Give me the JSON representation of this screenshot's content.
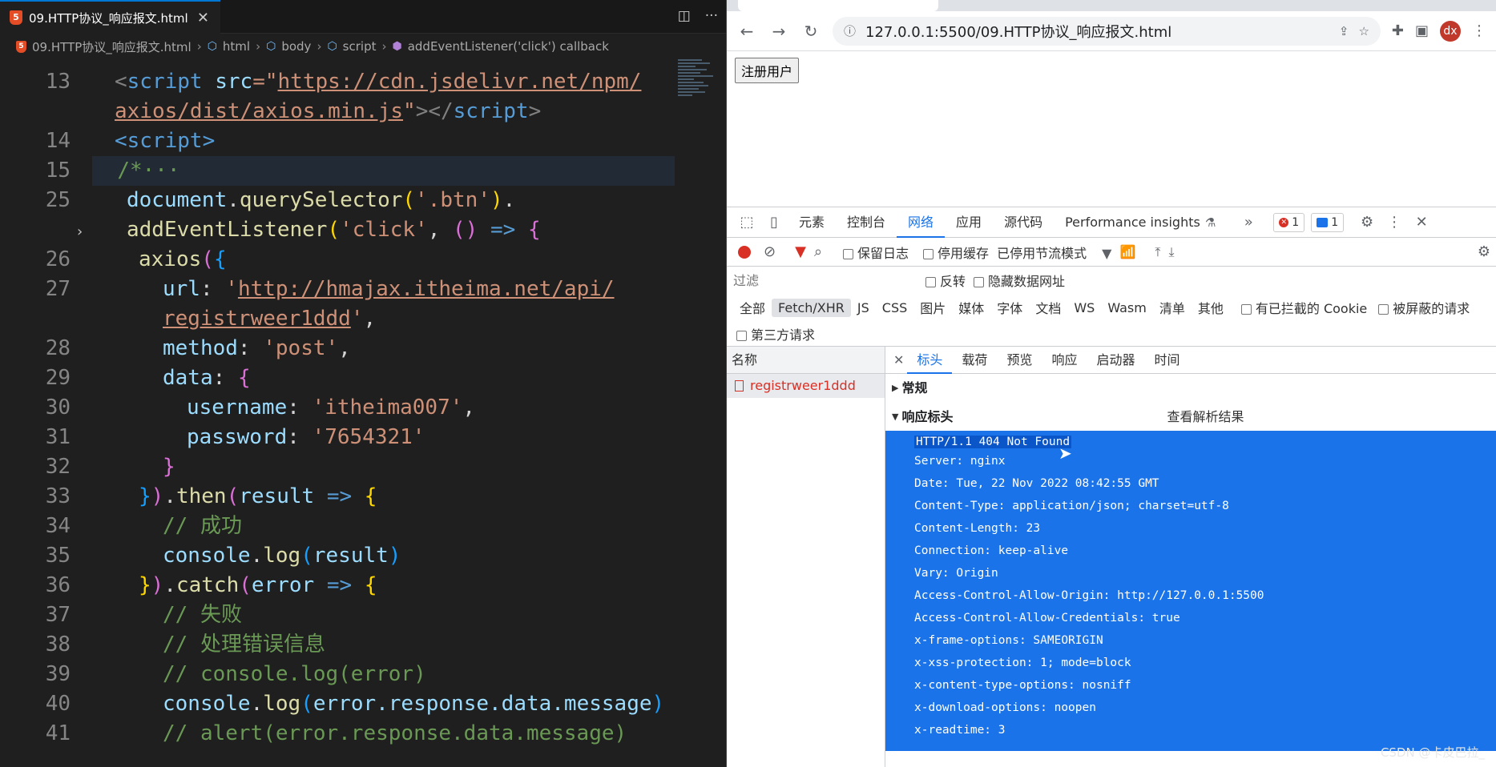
{
  "editor": {
    "tab_label": "09.HTTP协议_响应报文.html",
    "tab_close": "✕",
    "breadcrumb": [
      "09.HTTP协议_响应报文.html",
      "html",
      "body",
      "script",
      "addEventListener('click') callback"
    ],
    "line_numbers": [
      "13",
      "",
      "14",
      "15",
      "25",
      "",
      "26",
      "27",
      "",
      "28",
      "29",
      "30",
      "31",
      "32",
      "33",
      "34",
      "35",
      "36",
      "37",
      "38",
      "39",
      "40",
      "41"
    ],
    "code": {
      "l13a_tag": "<script ",
      "l13a_attr": "src",
      "l13a_eq": "=\"",
      "l13a_url": "https://cdn.jsdelivr.net/npm/",
      "l13b_url": "axios/dist/axios.min.js",
      "l13b_end": "\"></",
      "l13b_tag": "script",
      "l13b_close": ">",
      "l14": "<script>",
      "l15": "/*···",
      "l25a_obj": "document",
      "l25a_fn": "querySelector",
      "l25a_str": "'.btn'",
      "l25b_fn": "addEventListener",
      "l25b_str": "'click'",
      "l26_fn": "axios",
      "l27_key": "url",
      "l27_url1": "http://hmajax.itheima.net/api/",
      "l27_url2": "registrweer1ddd",
      "l28_key": "method",
      "l28_val": "'post'",
      "l29_key": "data",
      "l30_key": "username",
      "l30_val": "'itheima007'",
      "l31_key": "password",
      "l31_val": "'7654321'",
      "l33_fn": "then",
      "l33_arg": "result",
      "l34": "// 成功",
      "l35_obj": "console",
      "l35_fn": "log",
      "l35_arg": "result",
      "l36_fn": "catch",
      "l36_arg": "error",
      "l37": "// 失败",
      "l38": "// 处理错误信息",
      "l39": "// console.log(error)",
      "l40_obj": "console",
      "l40_fn": "log",
      "l40_arg": "error.response.data.message",
      "l41": "// alert(error.response.data.message)"
    }
  },
  "browser": {
    "url": "127.0.0.1:5500/09.HTTP协议_响应报文.html",
    "avatar": "dx",
    "register_button": "注册用户"
  },
  "devtools": {
    "tabs": [
      "元素",
      "控制台",
      "网络",
      "应用",
      "源代码",
      "Performance insights"
    ],
    "active_tab": "网络",
    "error_count": "1",
    "message_count": "1",
    "toolbar": {
      "preserve_log": "保留日志",
      "disable_cache": "停用缓存",
      "throttle": "已停用节流模式"
    },
    "filter": {
      "placeholder": "过滤",
      "invert": "反转",
      "hide_data_urls": "隐藏数据网址"
    },
    "types": [
      "全部",
      "Fetch/XHR",
      "JS",
      "CSS",
      "图片",
      "媒体",
      "字体",
      "文档",
      "WS",
      "Wasm",
      "清单",
      "其他"
    ],
    "blocked_cookies": "有已拦截的 Cookie",
    "blocked_requests": "被屏蔽的请求",
    "third_party": "第三方请求",
    "name_header": "名称",
    "request_name": "registrweer1ddd",
    "detail_tabs": [
      "标头",
      "载荷",
      "预览",
      "响应",
      "启动器",
      "时间"
    ],
    "general_section": "常规",
    "response_headers_section": "响应标头",
    "view_parsed": "查看解析结果",
    "status_line": "HTTP/1.1 404 Not Found",
    "headers": [
      "Server: nginx",
      "Date: Tue, 22 Nov 2022 08:42:55 GMT",
      "Content-Type: application/json; charset=utf-8",
      "Content-Length: 23",
      "Connection: keep-alive",
      "Vary: Origin",
      "Access-Control-Allow-Origin: http://127.0.0.1:5500",
      "Access-Control-Allow-Credentials: true",
      "x-frame-options: SAMEORIGIN",
      "x-xss-protection: 1; mode=block",
      "x-content-type-options: nosniff",
      "x-download-options: noopen",
      "x-readtime: 3"
    ]
  },
  "watermark": "CSDN @卡皮巴拉_"
}
